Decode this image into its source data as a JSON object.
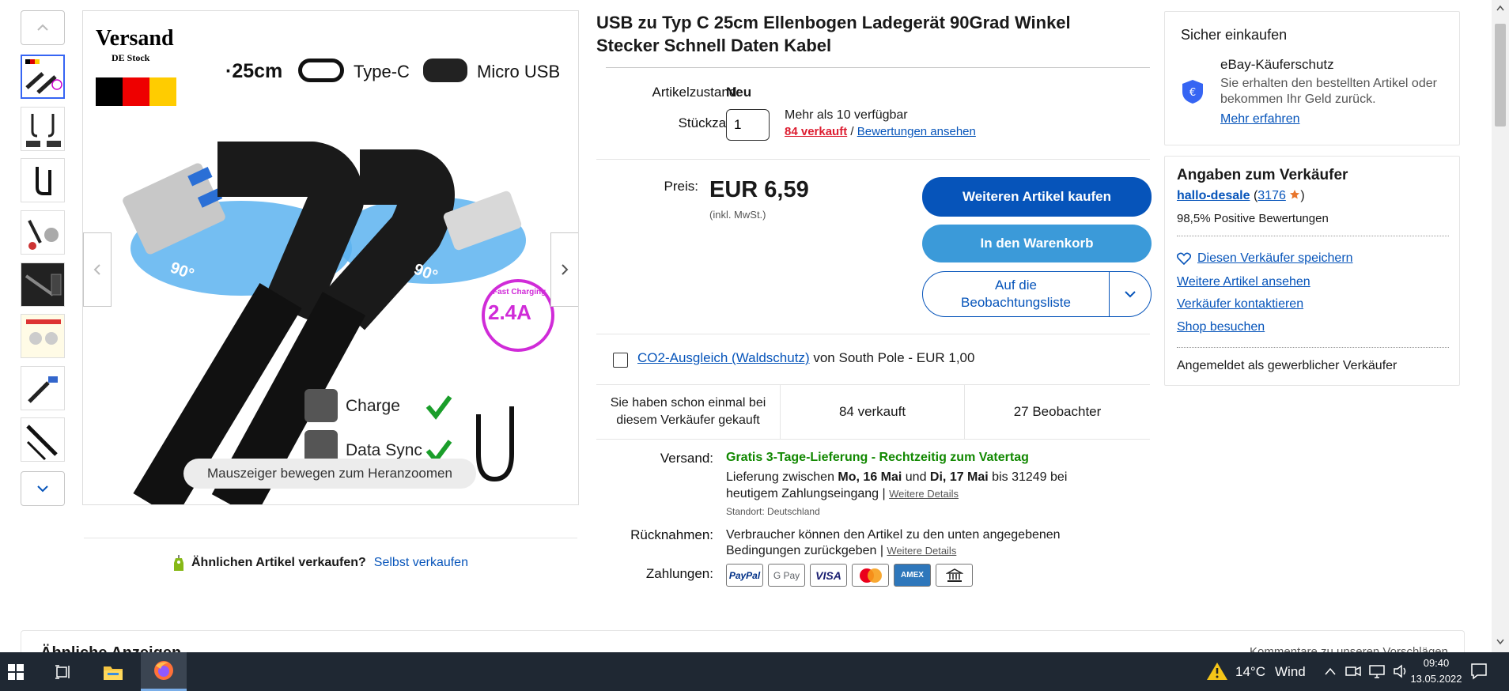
{
  "gallery": {
    "nav_up_icon": "chevron-up-icon",
    "nav_down_icon": "chevron-down-icon",
    "thumbnail_count": 8,
    "zoom_hint": "Mauszeiger bewegen zum Heranzoomen",
    "image_text": {
      "brand_line1": "Versand",
      "brand_line2": "DE Stock",
      "length": "·25cm",
      "typec": "Type-C",
      "micro": "Micro USB",
      "angle_left": "90°",
      "angle_right": "90°",
      "fast_charging": "Fast Charging",
      "amps": "2.4A",
      "charge": "Charge",
      "data_sync": "Data Sync"
    }
  },
  "sell_similar": {
    "question": "Ähnlichen Artikel verkaufen?",
    "link": "Selbst verkaufen"
  },
  "listing": {
    "title": "USB zu Typ C 25cm Ellenbogen Ladegerät 90Grad Winkel Stecker Schnell Daten Kabel",
    "condition_label": "Artikelzustand:",
    "condition_value": "Neu",
    "quantity_label": "Stückzahl:",
    "quantity_value": "1",
    "availability": "Mehr als 10 verfügbar",
    "sold_link": "84 verkauft",
    "separator": "/",
    "reviews_link": "Bewertungen ansehen",
    "price_label": "Preis:",
    "price": "EUR 6,59",
    "price_note": "(inkl. MwSt.)",
    "buy_button": "Weiteren Artikel kaufen",
    "cart_button": "In den Warenkorb",
    "watch_button_line1": "Auf die",
    "watch_button_line2": "Beobachtungsliste",
    "co2_link": "CO2-Ausgleich (Waldschutz)",
    "co2_rest": "von South Pole - EUR 1,00",
    "stats": [
      "Sie haben schon einmal bei diesem Verkäufer gekauft",
      "84 verkauft",
      "27 Beobachter"
    ],
    "shipping_label": "Versand:",
    "shipping_title": "Gratis 3-Tage-Lieferung - Rechtzeitig zum Vatertag",
    "shipping_text_a": "Lieferung zwischen ",
    "shipping_date1": "Mo, 16 Mai",
    "shipping_text_b": " und ",
    "shipping_date2": "Di, 17 Mai",
    "shipping_text_c": " bis 31249 bei heutigem Zahlungseingang | ",
    "shipping_details_link": "Weitere Details",
    "location": "Standort: Deutschland",
    "returns_label": "Rücknahmen:",
    "returns_text": "Verbraucher können den Artikel zu den unten angegebenen Bedingungen zurückgeben | ",
    "returns_details_link": "Weitere Details",
    "payments_label": "Zahlungen:",
    "payments": [
      "PayPal",
      "G Pay",
      "VISA",
      "",
      "AMEX",
      ""
    ]
  },
  "safe_shopping": {
    "heading": "Sicher einkaufen",
    "protection_title": "eBay-Käuferschutz",
    "protection_text": "Sie erhalten den bestellten Artikel oder bekommen Ihr Geld zurück.",
    "learn_more": "Mehr erfahren"
  },
  "seller": {
    "heading": "Angaben zum Verkäufer",
    "name": "hallo-desale",
    "open_paren": "(",
    "score": "3176",
    "close_paren": ")",
    "positive": "98,5% Positive Bewertungen",
    "save_seller": "Diesen Verkäufer speichern",
    "more_items": "Weitere Artikel ansehen",
    "contact": "Verkäufer kontaktieren",
    "shop": "Shop besuchen",
    "business": "Angemeldet als gewerblicher Verkäufer"
  },
  "below": {
    "partial_left": "Ähnliche Anzeigen",
    "partial_right": "Kommentare zu unseren Vorschlägen"
  },
  "taskbar": {
    "weather_temp": "14°C",
    "weather_text": "Wind",
    "time": "09:40",
    "date": "13.05.2022"
  },
  "colors": {
    "primary_blue": "#0654ba",
    "button_blue": "#3665f3",
    "cart_blue": "#3b9ad9",
    "sold_red": "#dd1e31",
    "shipping_green": "#118800"
  }
}
